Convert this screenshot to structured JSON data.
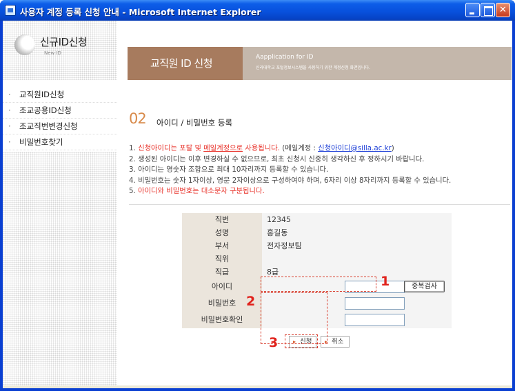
{
  "window": {
    "title": "사용자 계정 등록 신청 안내 - Microsoft Internet Explorer"
  },
  "sidebar": {
    "logo_title": "신규ID신청",
    "logo_sub": "New ID",
    "items": [
      {
        "label": "교직원ID신청"
      },
      {
        "label": "조교공용ID신청"
      },
      {
        "label": "조교직번변경신청"
      },
      {
        "label": "비밀번호찾기"
      }
    ]
  },
  "banner": {
    "title": "교직원 ID 신청",
    "en": "Aapplication for ID",
    "desc": "신라대학교 포털정보시스템을 사용하기 위한 계정신청 화면입니다."
  },
  "section": {
    "number": "02",
    "title": "아이디 / 비밀번호 등록"
  },
  "notes": {
    "n1_prefix": "1. ",
    "n1_red_a": "신청아이디는 포탈 및 ",
    "n1_red_link": "메일계정으로",
    "n1_red_b": " 사용됩니다.",
    "n1_mid": " (메일계정 : ",
    "n1_link": "신청아이디@silla.ac.kr",
    "n1_end": ")",
    "n2": "2. 생성된 아이디는 이후 변경하실 수 없으므로, 최초 신청시 신중히 생각하신 후 정하시기 바랍니다.",
    "n3": "3. 아이디는 영숫자 조합으로 최대 10자리까지 등록할 수 있습니다.",
    "n4": "4. 비밀번호는 숫자 1자이상, 영문 2자이상으로 구성하여야 하며, 6자리 이상 8자리까지 등록할 수 있습니다.",
    "n5_prefix": "5. ",
    "n5_red": "아이디와 비밀번호는 대소문자 구분됩니다."
  },
  "form": {
    "rows": [
      {
        "label": "직번",
        "value": "12345"
      },
      {
        "label": "성명",
        "value": "홍길동"
      },
      {
        "label": "부서",
        "value": "전자정보팀"
      },
      {
        "label": "직위",
        "value": ""
      },
      {
        "label": "직급",
        "value": "8급"
      }
    ],
    "id_label": "아이디",
    "id_value": "",
    "dup_check": "중복검사",
    "pw_label": "비밀번호",
    "pw_confirm_label": "비밀번호확인"
  },
  "buttons": {
    "apply": "신청",
    "cancel": "취소"
  },
  "annotations": {
    "one": "1",
    "two": "2",
    "three": "3"
  }
}
